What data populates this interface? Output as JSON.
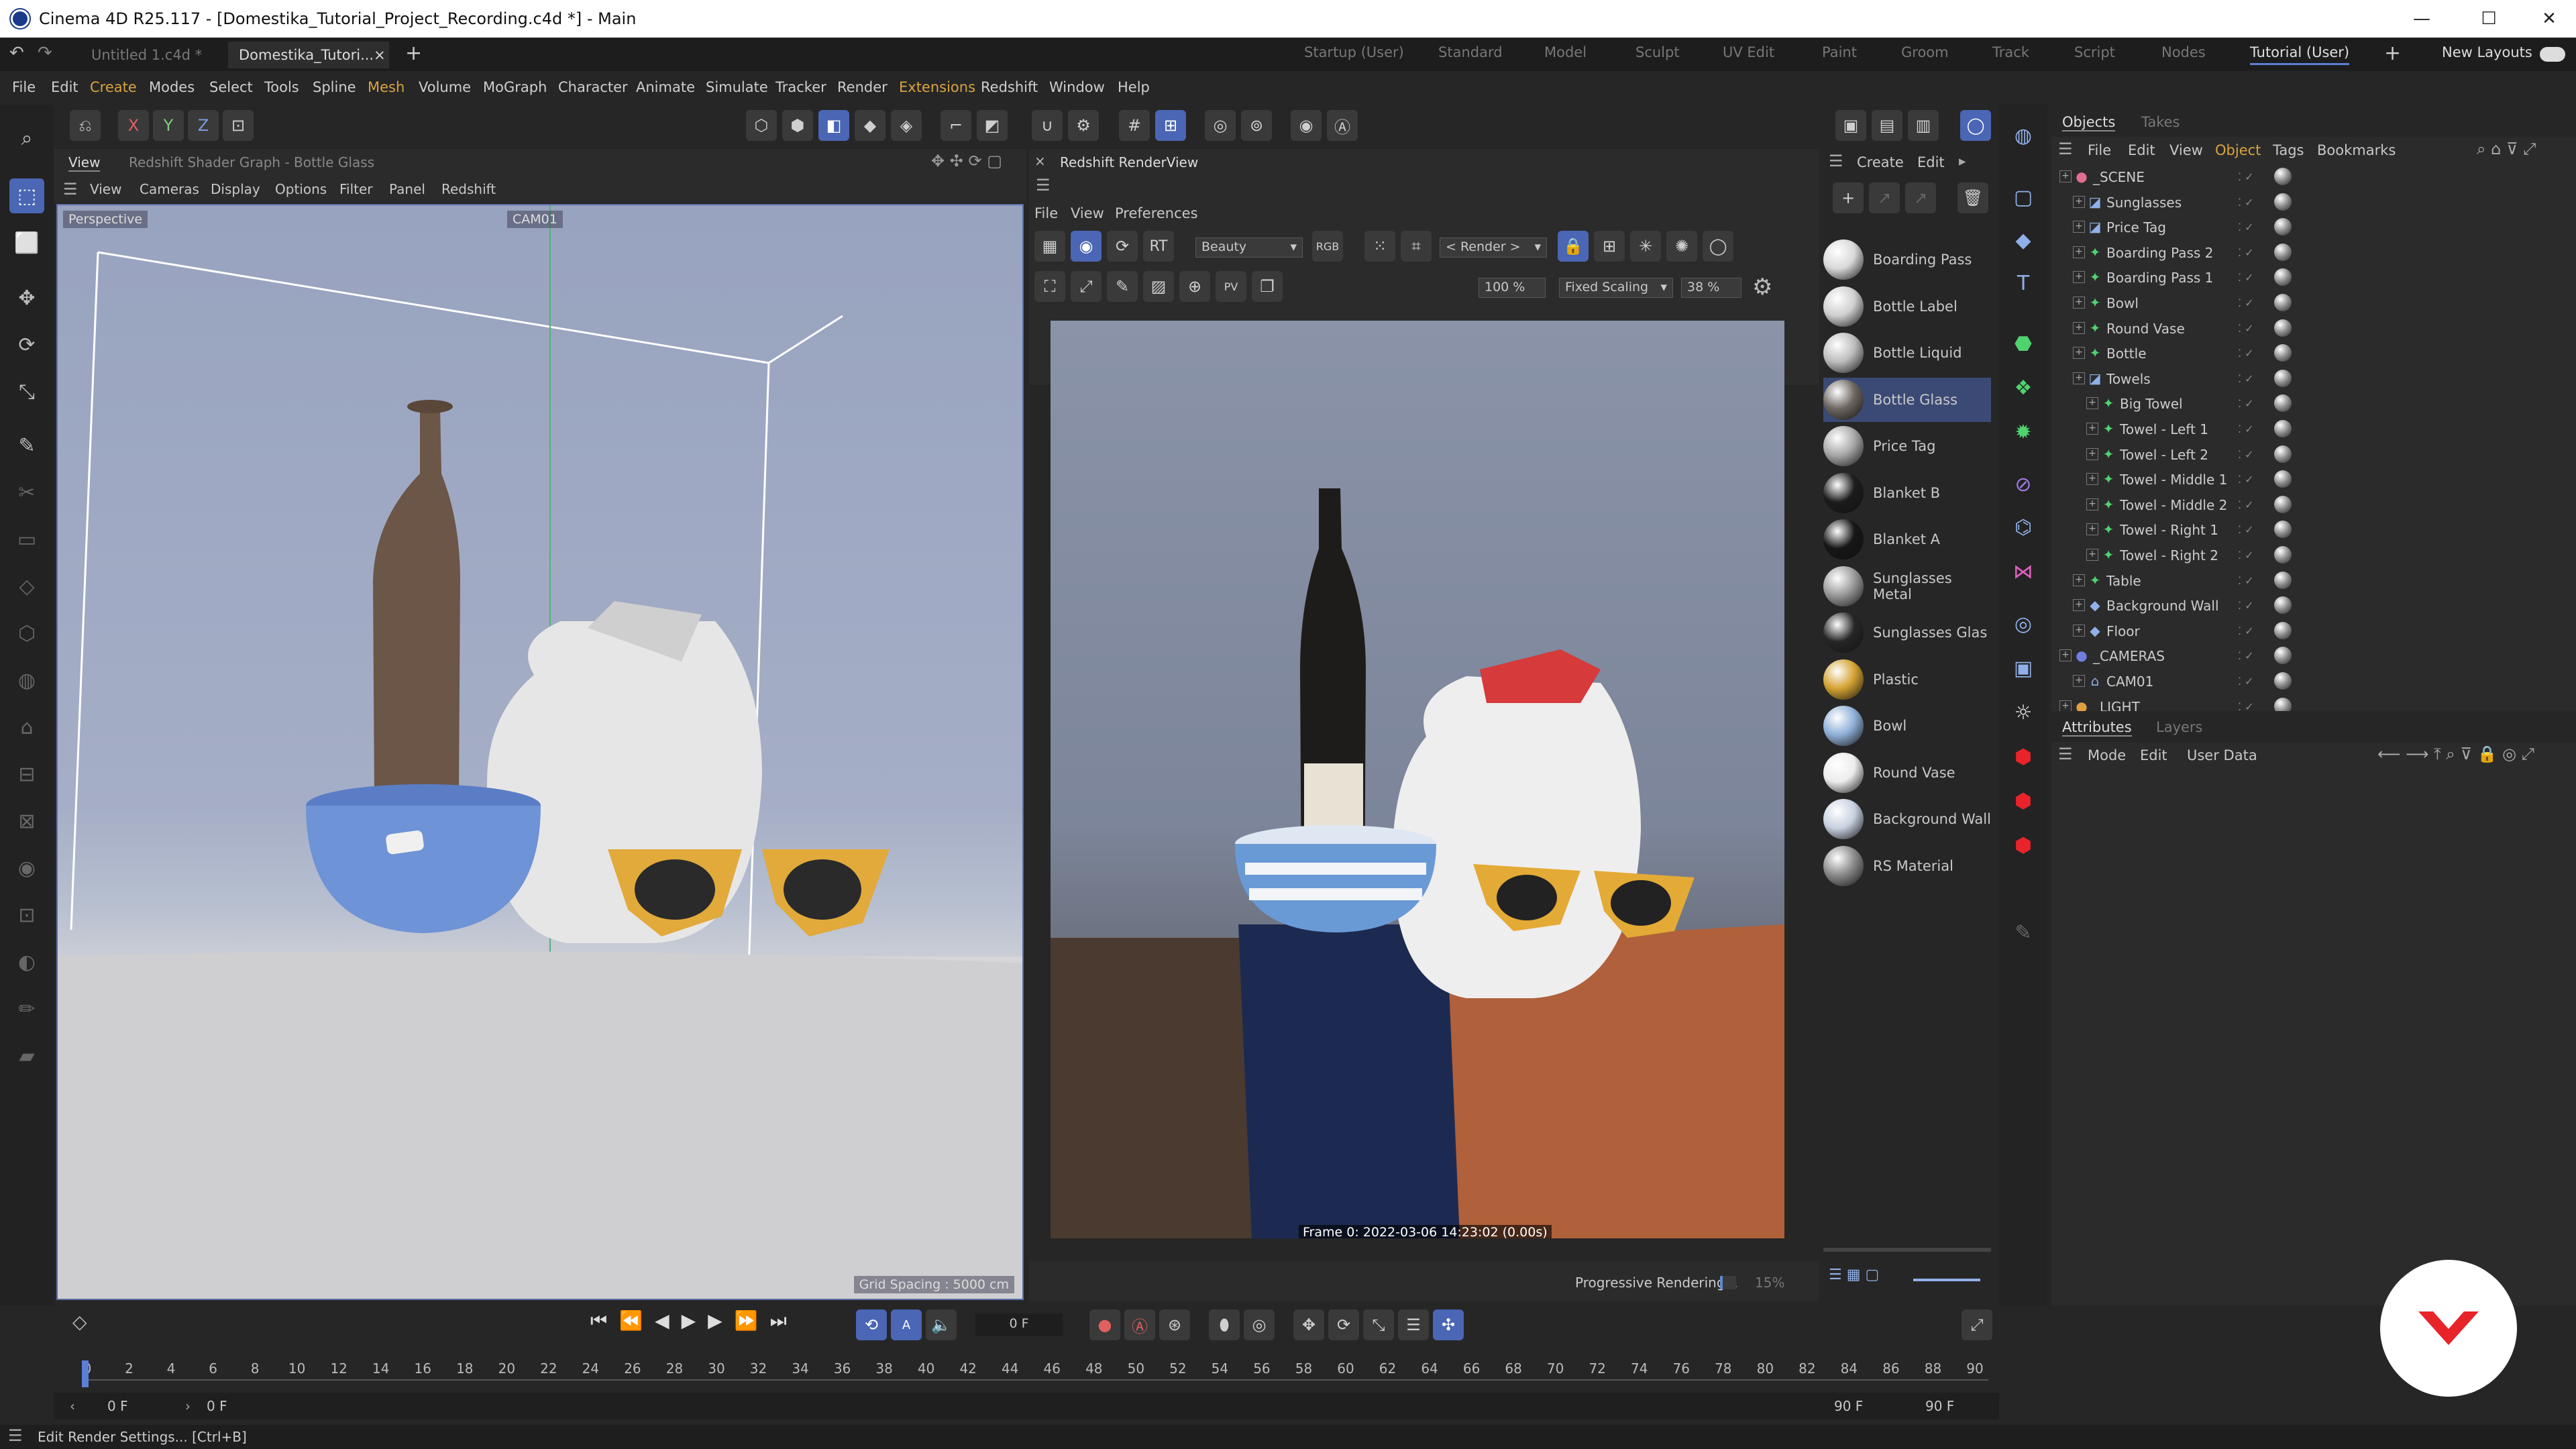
{
  "window": {
    "title": "Cinema 4D R25.117 - [Domestika_Tutorial_Project_Recording.c4d *] - Main",
    "minimize": "—",
    "maximize": "☐",
    "close": "✕"
  },
  "doc_tabs": [
    {
      "label": "Untitled 1.c4d *"
    },
    {
      "label": "Domestika_Tutori..."
    }
  ],
  "doc_tab_close": "×",
  "doc_tab_add": "+",
  "layouts": [
    "Startup (User)",
    "Standard",
    "Model",
    "Sculpt",
    "UV Edit",
    "Paint",
    "Groom",
    "Track",
    "Script",
    "Nodes",
    "Tutorial (User)"
  ],
  "layout_add": "+",
  "new_layouts": "New Layouts",
  "menu": [
    "File",
    "Edit",
    "Create",
    "Modes",
    "Select",
    "Tools",
    "Spline",
    "Mesh",
    "Volume",
    "MoGraph",
    "Character",
    "Animate",
    "Simulate",
    "Tracker",
    "Render",
    "Extensions",
    "Redshift",
    "Window",
    "Help"
  ],
  "axis_lock": {
    "x": "X",
    "y": "Y",
    "z": "Z"
  },
  "viewport": {
    "panel_tab": "View",
    "secondary_tab": "Redshift Shader Graph - Bottle Glass",
    "menu": [
      "View",
      "Cameras",
      "Display",
      "Options",
      "Filter",
      "Panel",
      "Redshift"
    ],
    "projection": "Perspective",
    "camera": "CAM01",
    "grid_spacing": "Grid Spacing : 5000 cm"
  },
  "renderview": {
    "title": "Redshift RenderView",
    "menu": [
      "File",
      "View",
      "Preferences"
    ],
    "aov": "Beauty",
    "render_target": "< Render >",
    "zoom": "100 %",
    "scaling": "Fixed Scaling",
    "scaling_percent": "38 %",
    "frame_info": "Frame  0:  2022-03-06  14:23:02  (0.00s)",
    "status": "Progressive Rendering...",
    "progress_percent": "15%",
    "progress": 0.15
  },
  "materials": {
    "create": "Create",
    "edit": "Edit",
    "items": [
      {
        "name": "Boarding Pass",
        "color": "#d8d8d8"
      },
      {
        "name": "Bottle Label",
        "color": "#cfcfcf"
      },
      {
        "name": "Bottle Liquid",
        "color": "#bcbcbc"
      },
      {
        "name": "Bottle Glass",
        "color": "#6d6660"
      },
      {
        "name": "Price Tag",
        "color": "#a8a8a8"
      },
      {
        "name": "Blanket B",
        "color": "#1c1c1c"
      },
      {
        "name": "Blanket A",
        "color": "#161616"
      },
      {
        "name": "Sunglasses Metal",
        "color": "#9a9a9a"
      },
      {
        "name": "Sunglasses Glas",
        "color": "#262626"
      },
      {
        "name": "Plastic",
        "color": "#d4a232"
      },
      {
        "name": "Bowl",
        "color": "#8fb0d8"
      },
      {
        "name": "Round Vase",
        "color": "#ececec"
      },
      {
        "name": "Background Wall",
        "color": "#c8d0e0"
      },
      {
        "name": "RS Material",
        "color": "#8a8a8a"
      }
    ]
  },
  "objects": {
    "tabs": [
      "Objects",
      "Takes"
    ],
    "menu": [
      "File",
      "Edit",
      "View",
      "Object",
      "Tags",
      "Bookmarks"
    ],
    "rows": [
      {
        "name": "_SCENE",
        "depth": 0,
        "icon": "●",
        "color": "#e06f8f"
      },
      {
        "name": "Sunglasses",
        "depth": 1,
        "icon": "◪",
        "color": "#8fb0e8"
      },
      {
        "name": "Price Tag",
        "depth": 1,
        "icon": "◪",
        "color": "#8fb0e8"
      },
      {
        "name": "Boarding Pass 2",
        "depth": 1,
        "icon": "✦",
        "color": "#4fd36f"
      },
      {
        "name": "Boarding Pass 1",
        "depth": 1,
        "icon": "✦",
        "color": "#4fd36f"
      },
      {
        "name": "Bowl",
        "depth": 1,
        "icon": "✦",
        "color": "#4fd36f"
      },
      {
        "name": "Round Vase",
        "depth": 1,
        "icon": "✦",
        "color": "#4fd36f"
      },
      {
        "name": "Bottle",
        "depth": 1,
        "icon": "✦",
        "color": "#4fd36f"
      },
      {
        "name": "Towels",
        "depth": 1,
        "icon": "◪",
        "color": "#8fb0e8"
      },
      {
        "name": "Big Towel",
        "depth": 2,
        "icon": "✦",
        "color": "#4fd36f"
      },
      {
        "name": "Towel - Left 1",
        "depth": 2,
        "icon": "✦",
        "color": "#4fd36f"
      },
      {
        "name": "Towel - Left 2",
        "depth": 2,
        "icon": "✦",
        "color": "#4fd36f"
      },
      {
        "name": "Towel - Middle 1",
        "depth": 2,
        "icon": "✦",
        "color": "#4fd36f"
      },
      {
        "name": "Towel - Middle 2",
        "depth": 2,
        "icon": "✦",
        "color": "#4fd36f"
      },
      {
        "name": "Towel - Right 1",
        "depth": 2,
        "icon": "✦",
        "color": "#4fd36f"
      },
      {
        "name": "Towel - Right 2",
        "depth": 2,
        "icon": "✦",
        "color": "#4fd36f"
      },
      {
        "name": "Table",
        "depth": 1,
        "icon": "✦",
        "color": "#4fd36f"
      },
      {
        "name": "Background Wall",
        "depth": 1,
        "icon": "◆",
        "color": "#8fb0e8"
      },
      {
        "name": "Floor",
        "depth": 1,
        "icon": "◆",
        "color": "#8fb0e8"
      },
      {
        "name": "_CAMERAS",
        "depth": 0,
        "icon": "●",
        "color": "#6f7fe0"
      },
      {
        "name": "CAM01",
        "depth": 1,
        "icon": "⌂",
        "color": "#8fb0e8"
      },
      {
        "name": "_LIGHT",
        "depth": 0,
        "icon": "●",
        "color": "#e0a040"
      }
    ]
  },
  "attributes": {
    "tabs": [
      "Attributes",
      "Layers"
    ],
    "menu": [
      "Mode",
      "Edit",
      "User Data"
    ]
  },
  "timeline": {
    "current_frame": "0 F",
    "start_frame": "0 F",
    "end_frame": "90 F",
    "end_frame_2": "90 F",
    "field_start": "0 F",
    "ticks": [
      "0",
      "2",
      "4",
      "6",
      "8",
      "10",
      "12",
      "14",
      "16",
      "18",
      "20",
      "22",
      "24",
      "26",
      "28",
      "30",
      "32",
      "34",
      "36",
      "38",
      "40",
      "42",
      "44",
      "46",
      "48",
      "50",
      "52",
      "54",
      "56",
      "58",
      "60",
      "62",
      "64",
      "66",
      "68",
      "70",
      "72",
      "74",
      "76",
      "78",
      "80",
      "82",
      "84",
      "86",
      "88",
      "90"
    ]
  },
  "status_bar": "Edit Render Settings... [Ctrl+B]",
  "colors": {
    "accent": "#4a66b4",
    "brand": "#e8232a",
    "highlight_menu": "#d9a441"
  }
}
